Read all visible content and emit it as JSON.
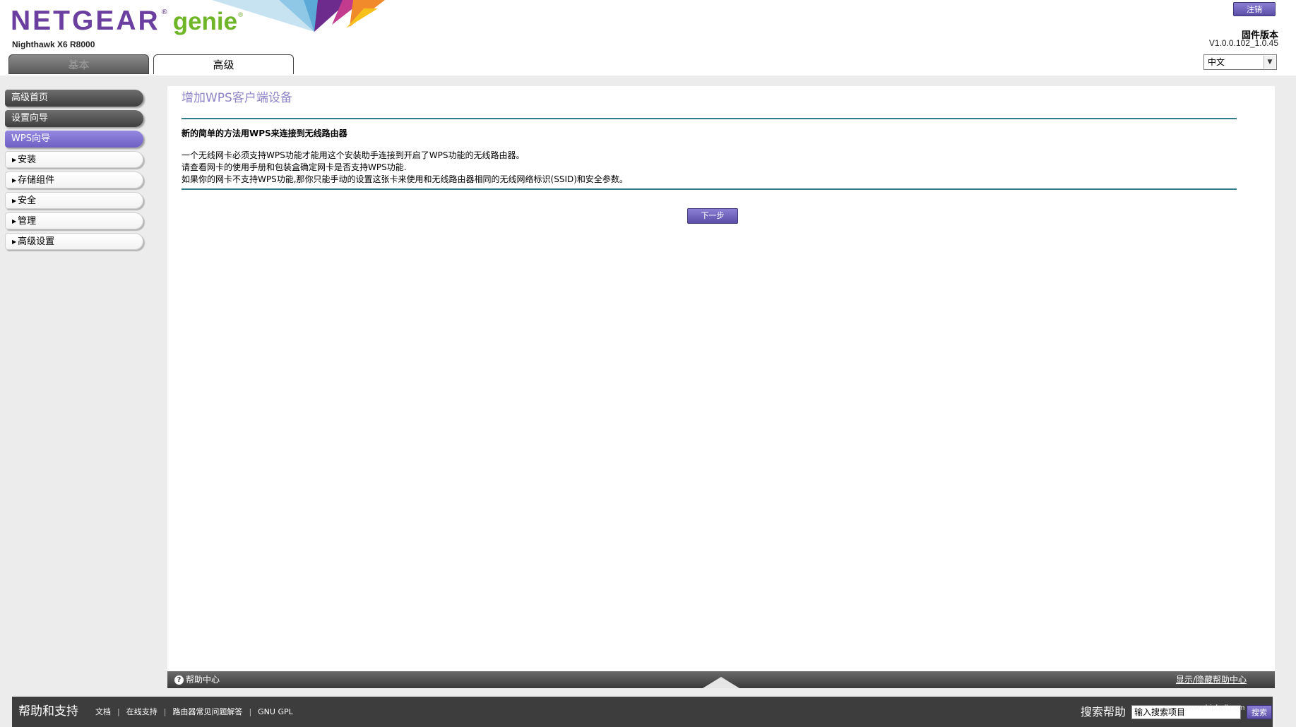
{
  "header": {
    "brand": "NETGEAR",
    "brand_reg": "®",
    "product": "genie",
    "product_reg": "®",
    "model": "Nighthawk X6 R8000",
    "logout_label": "注销",
    "firmware_label": "固件版本",
    "firmware_version": "V1.0.0.102_1.0.45",
    "language": "中文",
    "tabs": [
      {
        "label": "基本",
        "active": false
      },
      {
        "label": "高级",
        "active": true
      }
    ]
  },
  "sidebar": {
    "items": [
      {
        "label": "高级首页"
      },
      {
        "label": "设置向导"
      },
      {
        "label": "WPS向导"
      },
      {
        "label": "安装"
      },
      {
        "label": "存储组件"
      },
      {
        "label": "安全"
      },
      {
        "label": "管理"
      },
      {
        "label": "高级设置"
      }
    ]
  },
  "main": {
    "title": "增加WPS客户端设备",
    "heading": "新的简单的方法用WPS来连接到无线路由器",
    "lines": [
      "一个无线网卡必须支持WPS功能才能用这个安装助手连接到开启了WPS功能的无线路由器。",
      "请查看网卡的使用手册和包装盒确定网卡是否支持WPS功能.",
      "如果你的网卡不支持WPS功能,那你只能手动的设置这张卡来使用和无线路由器相同的无线网络标识(SSID)和安全参数。"
    ],
    "next_label": "下一步"
  },
  "help_bar": {
    "help_center": "帮助中心",
    "toggle_label": "显示/隐藏帮助中心"
  },
  "footer": {
    "title": "帮助和支持",
    "links": [
      "文档",
      "在线支持",
      "路由器常见问题解答",
      "GNU GPL"
    ],
    "search_label": "搜索帮助",
    "search_value": "输入搜索项目",
    "search_button": "搜索"
  },
  "watermark": "www.chiphell.com",
  "colors": {
    "accent_purple": "#6d60c4",
    "brand_purple": "#6b3fa0",
    "genie_green": "#6fb528",
    "rule_teal": "#2f7a8b",
    "title_purple": "#8d83c7"
  }
}
